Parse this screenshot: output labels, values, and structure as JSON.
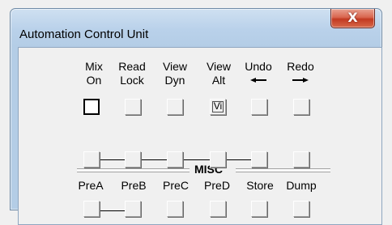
{
  "window": {
    "title": "Automation Control Unit",
    "close_label": "X"
  },
  "top_row": {
    "columns": [
      {
        "line1": "Mix",
        "line2": "On"
      },
      {
        "line1": "Read",
        "line2": "Lock"
      },
      {
        "line1": "View",
        "line2": "Dyn"
      },
      {
        "line1": "View",
        "line2": "Alt"
      },
      {
        "line1": "Undo",
        "icon": "left-arrow-icon"
      },
      {
        "line1": "Redo",
        "icon": "right-arrow-icon"
      }
    ],
    "button_texts": [
      "",
      "",
      "",
      "Vi",
      "",
      ""
    ],
    "active_button": "Mix On"
  },
  "misc": {
    "label": "MISC"
  },
  "bottom_labels": [
    "PreA",
    "PreB",
    "PreC",
    "PreD",
    "Store",
    "Dump"
  ]
}
